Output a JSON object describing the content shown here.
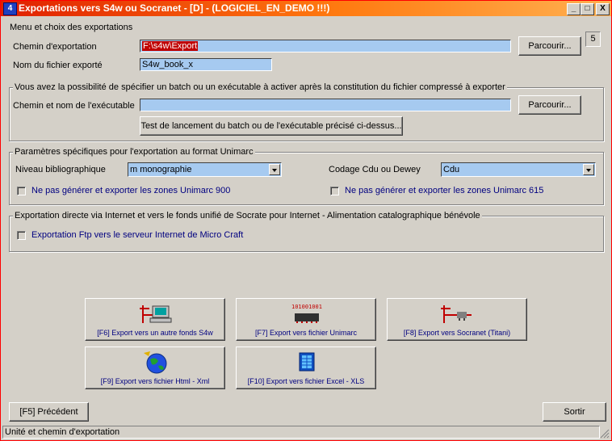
{
  "window": {
    "title": "Exportations vers S4w ou Socranet - [D] - (LOGICIEL_EN_DEMO !!!)",
    "app_icon": "4",
    "badge": "5",
    "controls": {
      "minimize": "_",
      "maximize": "□",
      "close": "X"
    }
  },
  "menu_group": {
    "legend": "Menu et choix des exportations",
    "export_path_label": "Chemin d'exportation",
    "export_path_value": "F:\\s4w\\Export",
    "file_name_label": "Nom du fichier exporté",
    "file_name_value": "S4w_book_x",
    "browse_label": "Parcourir..."
  },
  "batch_group": {
    "legend": "Vous avez la possibilité de spécifier un batch ou un exécutable à activer après la constitution du fichier compressé à exporter",
    "exe_path_label": "Chemin et nom de l'exécutable",
    "exe_path_value": "",
    "browse_label": "Parcourir...",
    "test_button": "Test de lancement du batch ou de l'exécutable précisé ci-dessus..."
  },
  "unimarc_group": {
    "legend": "Paramètres spécifiques pour l'exportation au format Unimarc",
    "level_label": "Niveau bibliographique",
    "level_value": "m monographie",
    "codage_label": "Codage Cdu ou Dewey",
    "codage_value": "Cdu",
    "check_900": "Ne pas générer et exporter les zones Unimarc 900",
    "check_615": "Ne pas générer et exporter les zones Unimarc 615"
  },
  "internet_group": {
    "legend": "Exportation directe via Internet et vers le fonds unifié de Socrate pour Internet - Alimentation catalographique bénévole",
    "check_ftp": "Exportation Ftp vers le serveur Internet de Micro Craft"
  },
  "actions": [
    {
      "label": "[F6] Export vers un autre fonds S4w",
      "icon": "computer-network-icon"
    },
    {
      "label": "[F7] Export vers fichier Unimarc",
      "icon": "binary-data-icon"
    },
    {
      "label": "[F8] Export vers Socranet (Titani)",
      "icon": "network-cable-icon"
    },
    {
      "label": "[F9] Export vers fichier Html - Xml",
      "icon": "globe-icon"
    },
    {
      "label": "[F10] Export vers fichier Excel - XLS",
      "icon": "spreadsheet-icon"
    }
  ],
  "binary_text": "101001001",
  "footer": {
    "previous": "[F5] Précédent",
    "exit": "Sortir"
  },
  "status": "Unité et chemin d'exportation",
  "colors": {
    "field_bg": "#a6caf0",
    "path_highlight": "#c00000",
    "window_bg": "#d4d0c8"
  }
}
